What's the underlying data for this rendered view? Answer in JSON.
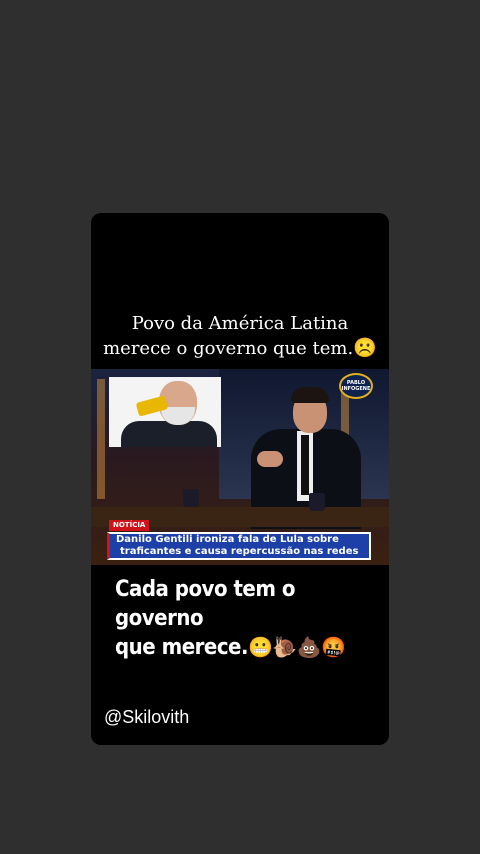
{
  "post": {
    "caption_line1": "Povo da América Latina",
    "caption_line2": "merece o governo que tem.",
    "caption_emoji": "☹️",
    "video": {
      "channel_logo": "PABLO INFOGENE",
      "tag": "NOTÍCIA",
      "headline_line1": "Danilo Gentili ironiza fala de Lula sobre",
      "headline_line2": "traficantes e causa repercussão nas redes"
    },
    "sticker_line1": "Cada povo tem o governo",
    "sticker_line2": "que merece.",
    "sticker_emojis": "😬🐌💩🤬",
    "handle": "@Skilovith"
  },
  "colors": {
    "page_bg": "#2f2f2f",
    "card_bg": "#000000",
    "headline_bg": "#1d3fa8",
    "tag_bg": "#d0121a"
  }
}
